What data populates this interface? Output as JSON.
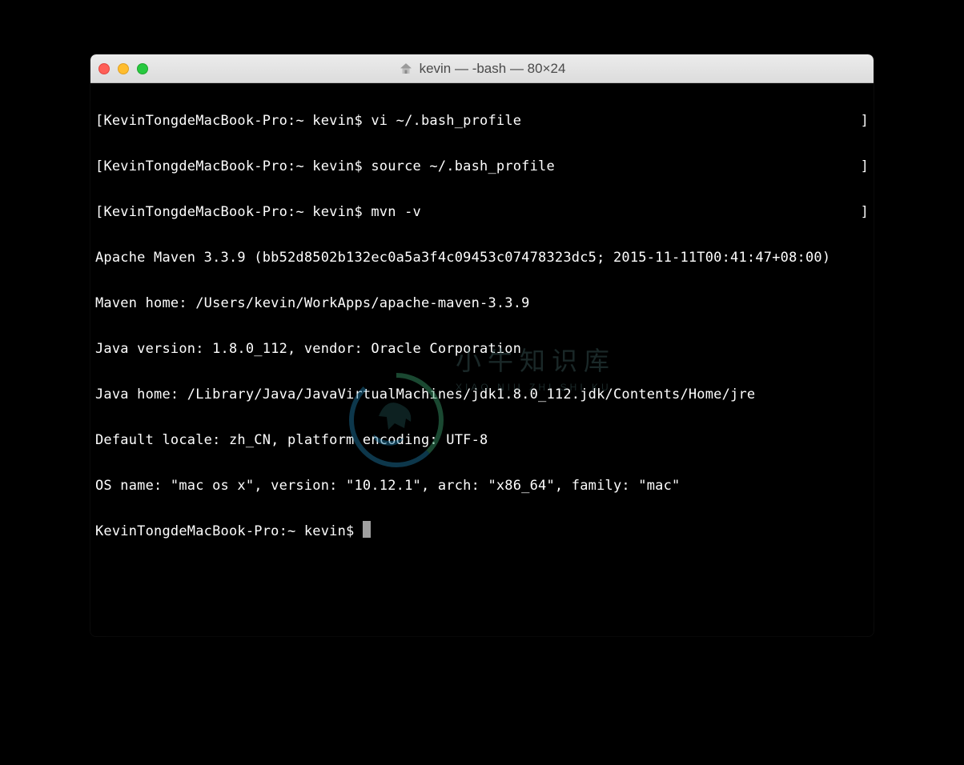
{
  "window": {
    "title": "kevin — -bash — 80×24"
  },
  "prompt": "KevinTongdeMacBook-Pro:~ kevin$",
  "commands": {
    "cmd1": "vi ~/.bash_profile",
    "cmd2": "source ~/.bash_profile",
    "cmd3": "mvn -v"
  },
  "output": {
    "line1": "Apache Maven 3.3.9 (bb52d8502b132ec0a5a3f4c09453c07478323dc5; 2015-11-11T00:41:47+08:00)",
    "line2": "Maven home: /Users/kevin/WorkApps/apache-maven-3.3.9",
    "line3": "Java version: 1.8.0_112, vendor: Oracle Corporation",
    "line4": "Java home: /Library/Java/JavaVirtualMachines/jdk1.8.0_112.jdk/Contents/Home/jre",
    "line5": "Default locale: zh_CN, platform encoding: UTF-8",
    "line6": "OS name: \"mac os x\", version: \"10.12.1\", arch: \"x86_64\", family: \"mac\""
  },
  "brackets": {
    "open": "[",
    "close": "]"
  },
  "watermark": {
    "title": "小牛知识库",
    "subtitle": "XIAO NIU ZHI SHI KU"
  }
}
